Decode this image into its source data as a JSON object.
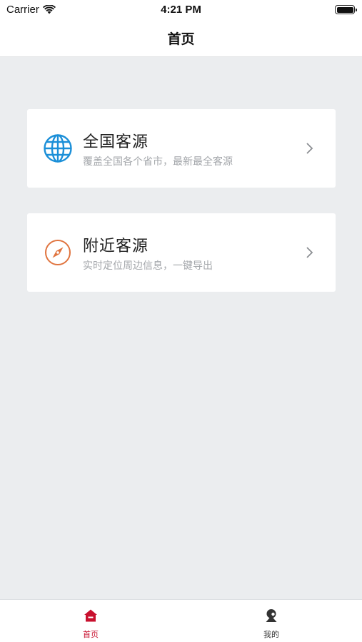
{
  "status_bar": {
    "carrier": "Carrier",
    "time": "4:21 PM"
  },
  "nav": {
    "title": "首页"
  },
  "cards": [
    {
      "title": "全国客源",
      "subtitle": "覆盖全国各个省市，最新最全客源",
      "icon": "globe-icon",
      "icon_color": "#1b8fd8"
    },
    {
      "title": "附近客源",
      "subtitle": "实时定位周边信息，一键导出",
      "icon": "compass-icon",
      "icon_color": "#e0743f"
    }
  ],
  "tab_bar": {
    "items": [
      {
        "label": "首页",
        "icon": "home-icon",
        "active": true
      },
      {
        "label": "我的",
        "icon": "user-icon",
        "active": false
      }
    ],
    "active_color": "#c8102e"
  }
}
